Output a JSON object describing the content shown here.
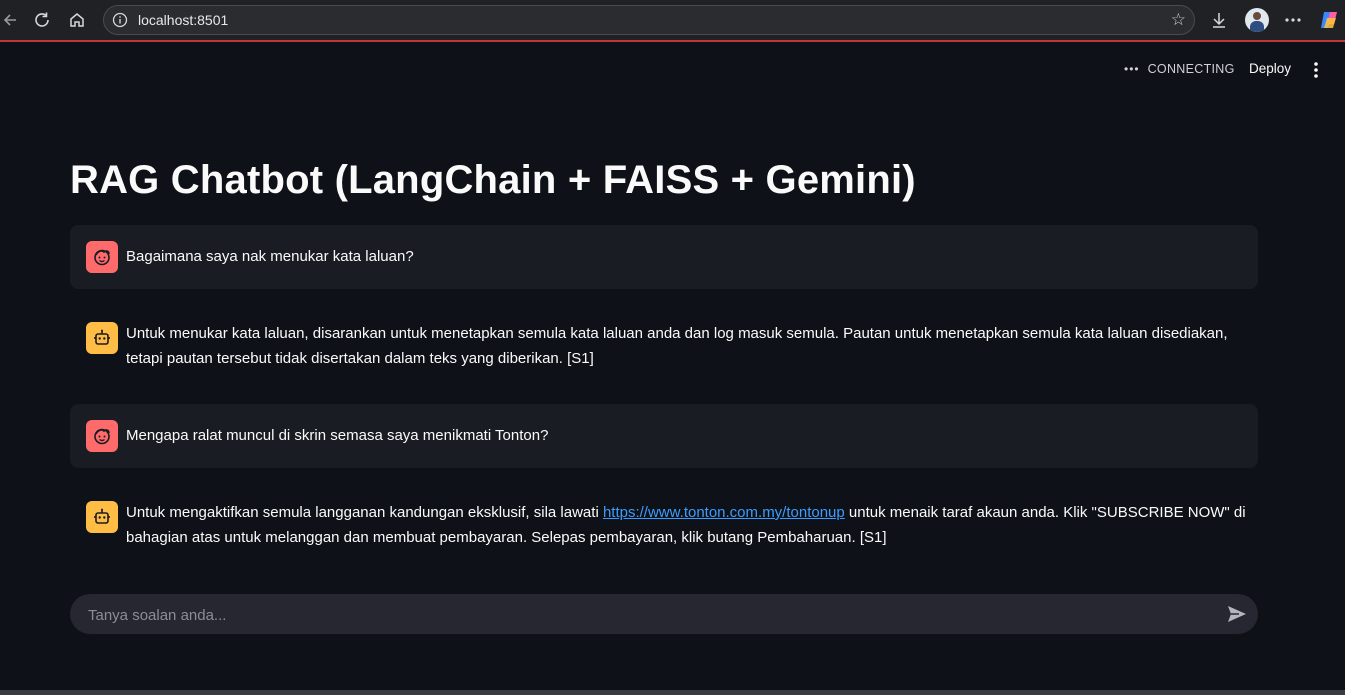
{
  "browser": {
    "url": "localhost:8501"
  },
  "app_header": {
    "status_label": "CONNECTING",
    "deploy_label": "Deploy"
  },
  "page": {
    "title": "RAG Chatbot (LangChain + FAISS + Gemini)"
  },
  "messages": [
    {
      "role": "user",
      "text": "Bagaimana saya nak menukar kata laluan?"
    },
    {
      "role": "assistant",
      "line1": "Untuk menukar kata laluan, disarankan untuk menetapkan semula kata laluan anda dan log masuk semula. Pautan untuk menetapkan semula kata laluan disediakan,",
      "line2": "tetapi pautan tersebut tidak disertakan dalam teks yang diberikan. [S1]"
    },
    {
      "role": "user",
      "text": "Mengapa ralat muncul di skrin semasa saya menikmati Tonton?"
    },
    {
      "role": "assistant",
      "pre_link": "Untuk mengaktifkan semula langganan kandungan eksklusif, sila lawati ",
      "link": "https://www.tonton.com.my/tontonup",
      "post_link": " untuk menaik taraf akaun anda. Klik \"SUBSCRIBE NOW\" di",
      "line2": "bahagian atas untuk melanggan dan membuat pembayaran. Selepas pembayaran, klik butang Pembaharuan. [S1]"
    }
  ],
  "chat_input": {
    "placeholder": "Tanya soalan anda..."
  },
  "colors": {
    "background": "#0e1117",
    "user_bubble": "#1a1c24",
    "user_avatar": "#ff6b6b",
    "assistant_avatar": "#ffbd45",
    "link": "#3b9cff",
    "input_bg": "#262730"
  }
}
